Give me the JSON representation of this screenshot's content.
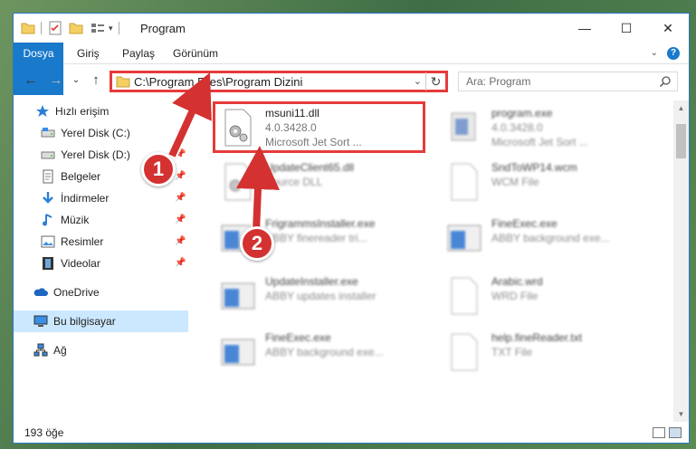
{
  "window": {
    "title": "Program",
    "controls": {
      "minimize": "—",
      "maximize": "☐",
      "close": "✕"
    }
  },
  "ribbon": {
    "tabs": [
      {
        "label": "Dosya",
        "active": true
      },
      {
        "label": "Giriş"
      },
      {
        "label": "Paylaş"
      },
      {
        "label": "Görünüm"
      }
    ],
    "help": "?"
  },
  "nav": {
    "back": "←",
    "forward": "→",
    "recent": "⌄",
    "up": "↑"
  },
  "address": {
    "path": "C:\\Program Files\\Program Dizini",
    "dropdown": "⌄",
    "refresh": "↻"
  },
  "search": {
    "placeholder": "Ara: Program"
  },
  "sidebar": {
    "items": [
      {
        "label": "Hızlı erişim",
        "icon": "star-icon"
      },
      {
        "label": "Yerel Disk (C:)",
        "icon": "drive-icon",
        "pinned": true
      },
      {
        "label": "Yerel Disk (D:)",
        "icon": "drive-icon",
        "pinned": true
      },
      {
        "label": "Belgeler",
        "icon": "documents-icon",
        "pinned": true
      },
      {
        "label": "İndirmeler",
        "icon": "download-icon",
        "pinned": true
      },
      {
        "label": "Müzik",
        "icon": "music-icon",
        "pinned": true
      },
      {
        "label": "Resimler",
        "icon": "pictures-icon",
        "pinned": true
      },
      {
        "label": "Videolar",
        "icon": "videos-icon",
        "pinned": true
      },
      {
        "label": "OneDrive",
        "icon": "cloud-icon"
      },
      {
        "label": "Bu bilgisayar",
        "icon": "computer-icon",
        "selected": true
      },
      {
        "label": "Ağ",
        "icon": "network-icon"
      }
    ]
  },
  "files": [
    {
      "name": "msuni11.dll",
      "line2": "4.0.3428.0",
      "line3": "Microsoft Jet Sort ...",
      "icon": "dll-gear-icon",
      "highlighted": true
    },
    {
      "name": "program.exe",
      "line2": "4.0.3428.0",
      "line3": "Microsoft Jet Sort ...",
      "icon": "exe-icon"
    },
    {
      "name": "UpdateClient65.dll",
      "line2": "Source DLL",
      "line3": "",
      "icon": "dll-gear-icon"
    },
    {
      "name": "SndToWP14.wcm",
      "line2": "WCM File",
      "line3": "",
      "icon": "blank-file-icon"
    },
    {
      "name": "FrigrammsInstaller.exe",
      "line2": "ABBY finereader tri...",
      "line3": "",
      "icon": "app-window-icon"
    },
    {
      "name": "FineExec.exe",
      "line2": "ABBY background exe...",
      "line3": "",
      "icon": "app-window-icon"
    },
    {
      "name": "UpdateInstaller.exe",
      "line2": "ABBY updates installer",
      "line3": "",
      "icon": "app-window-icon"
    },
    {
      "name": "Arabic.wrd",
      "line2": "WRD File",
      "line3": "",
      "icon": "blank-file-icon"
    },
    {
      "name": "FineExec.exe",
      "line2": "ABBY background exe...",
      "line3": "",
      "icon": "app-window-icon"
    },
    {
      "name": "help.fineReader.txt",
      "line2": "TXT File",
      "line3": "",
      "icon": "blank-file-icon"
    }
  ],
  "status": {
    "count": "193 öğe"
  },
  "callouts": [
    {
      "number": "1"
    },
    {
      "number": "2"
    }
  ],
  "colors": {
    "accent": "#1979ca",
    "callout": "#d43131",
    "highlight_border": "#e63b3b",
    "selected_bg": "#cce8ff"
  }
}
